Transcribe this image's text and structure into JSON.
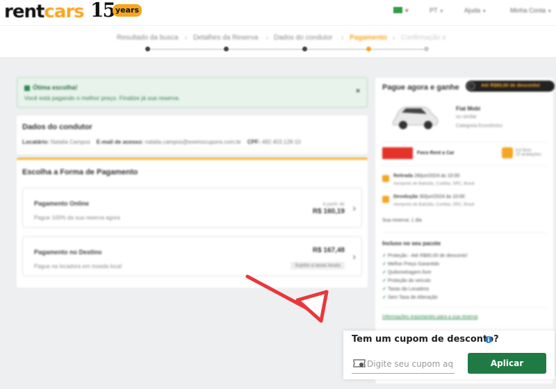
{
  "header": {
    "logo_main": "rent",
    "logo_accent": "cars",
    "anniversary_number": "15",
    "anniversary_label": "years",
    "lang": "PT",
    "help": "Ajuda",
    "account": "Minha Conta"
  },
  "steps": [
    {
      "label": "Resultado da busca",
      "state": "done"
    },
    {
      "label": "Detalhes da Reserva",
      "state": "done"
    },
    {
      "label": "Dados do condutor",
      "state": "done"
    },
    {
      "label": "Pagamento",
      "state": "active"
    },
    {
      "label": "Confirmação e",
      "state": "todo"
    }
  ],
  "alert": {
    "title": "Ótima escolha!",
    "text": "Você está pagando o melhor preço. Finalize já sua reserva.",
    "close": "×"
  },
  "driver": {
    "title": "Dados do condutor",
    "renter_label": "Locatário:",
    "renter_value": "Natalia Campos",
    "email_label": "E-mail de acesso:",
    "email_value": "natalia.campos@exemocupons.com.br",
    "cpf_label": "CPF:",
    "cpf_value": "482.403.128-10"
  },
  "payment": {
    "title": "Escolha a Forma de Pagamento",
    "options": [
      {
        "title": "Pagamento Online",
        "desc": "Pague 100% da sua reserva agora",
        "price_label": "A partir de",
        "price": "R$ 160,19",
        "tag": ""
      },
      {
        "title": "Pagamento no Destino",
        "desc": "Pague na locadora em moeda local",
        "price_label": "",
        "price": "R$ 167,48",
        "tag": "Sujeito a taxas locais"
      }
    ]
  },
  "sidebar": {
    "title": "Pague agora e ganhe",
    "badge": "Até R$80,00 de desconto!",
    "car_name": "Fiat Mobi",
    "car_sub": "ou similar",
    "car_category": "Categoria Econômico",
    "brand": "Foco Rent a Car",
    "score": "8,6",
    "score_text": "Bom",
    "score_reviews": "20 avaliações",
    "pickup_label": "Retirada",
    "pickup_date": "28/jun/2024 às 10:00",
    "pickup_place": "Aeroporto de Batistão, Curitiba, SRC, Brasil",
    "return_label": "Devolução",
    "return_date": "30/jun/2024 às 10:00",
    "return_place": "Aeroporto de Batistão, Curitiba, SRC, Brasil",
    "duration": "Sua reserva: 1 dia",
    "included_title": "Incluso no seu pacote",
    "included": [
      "Proteção - Até R$80,00 de desconto!",
      "Melhor Preço Garantido",
      "Quilometragem livre",
      "Proteção do veículo",
      "Taxas da Locadora",
      "Sem Taxa de Alteração"
    ],
    "info_link": "Informações importantes para a sua reserva"
  },
  "coupon": {
    "title": "Tem um cupom de desconto?",
    "placeholder": "Digite seu cupom aqui",
    "apply": "Aplicar"
  },
  "colors": {
    "accent": "#f5a623",
    "apply_button": "#1f7a44",
    "annotation_arrow": "#e8383b"
  }
}
